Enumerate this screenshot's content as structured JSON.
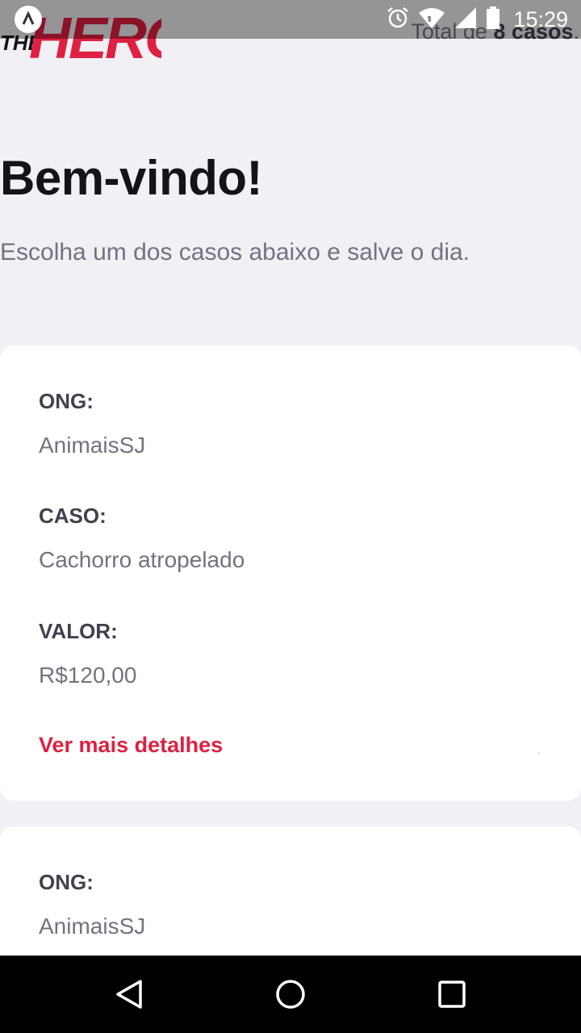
{
  "header": {
    "logo_text": "THE HERO",
    "total_prefix": "Total de ",
    "total_count": "8 casos",
    "total_suffix": "."
  },
  "status_bar": {
    "time": "15:29",
    "icons": [
      "app-notification-icon",
      "alarm-icon",
      "wifi-icon",
      "signal-icon",
      "battery-icon"
    ]
  },
  "welcome": {
    "title": "Bem-vindo!",
    "subtitle": "Escolha um dos casos abaixo e salve o dia."
  },
  "incidents": [
    {
      "ong_label": "ONG:",
      "ong": "AnimaisSJ",
      "caso_label": "CASO:",
      "caso": "Cachorro atropelado",
      "valor_label": "VALOR:",
      "valor": "R$120,00",
      "details_label": "Ver mais detalhes"
    },
    {
      "ong_label": "ONG:",
      "ong": "AnimaisSJ"
    }
  ],
  "nav_bar": {
    "icons": [
      "back-icon",
      "home-icon",
      "recents-icon"
    ]
  },
  "colors": {
    "accent": "#e02041",
    "background": "#f0f0f5",
    "title": "#13131a",
    "text": "#737380",
    "label": "#41414d"
  }
}
